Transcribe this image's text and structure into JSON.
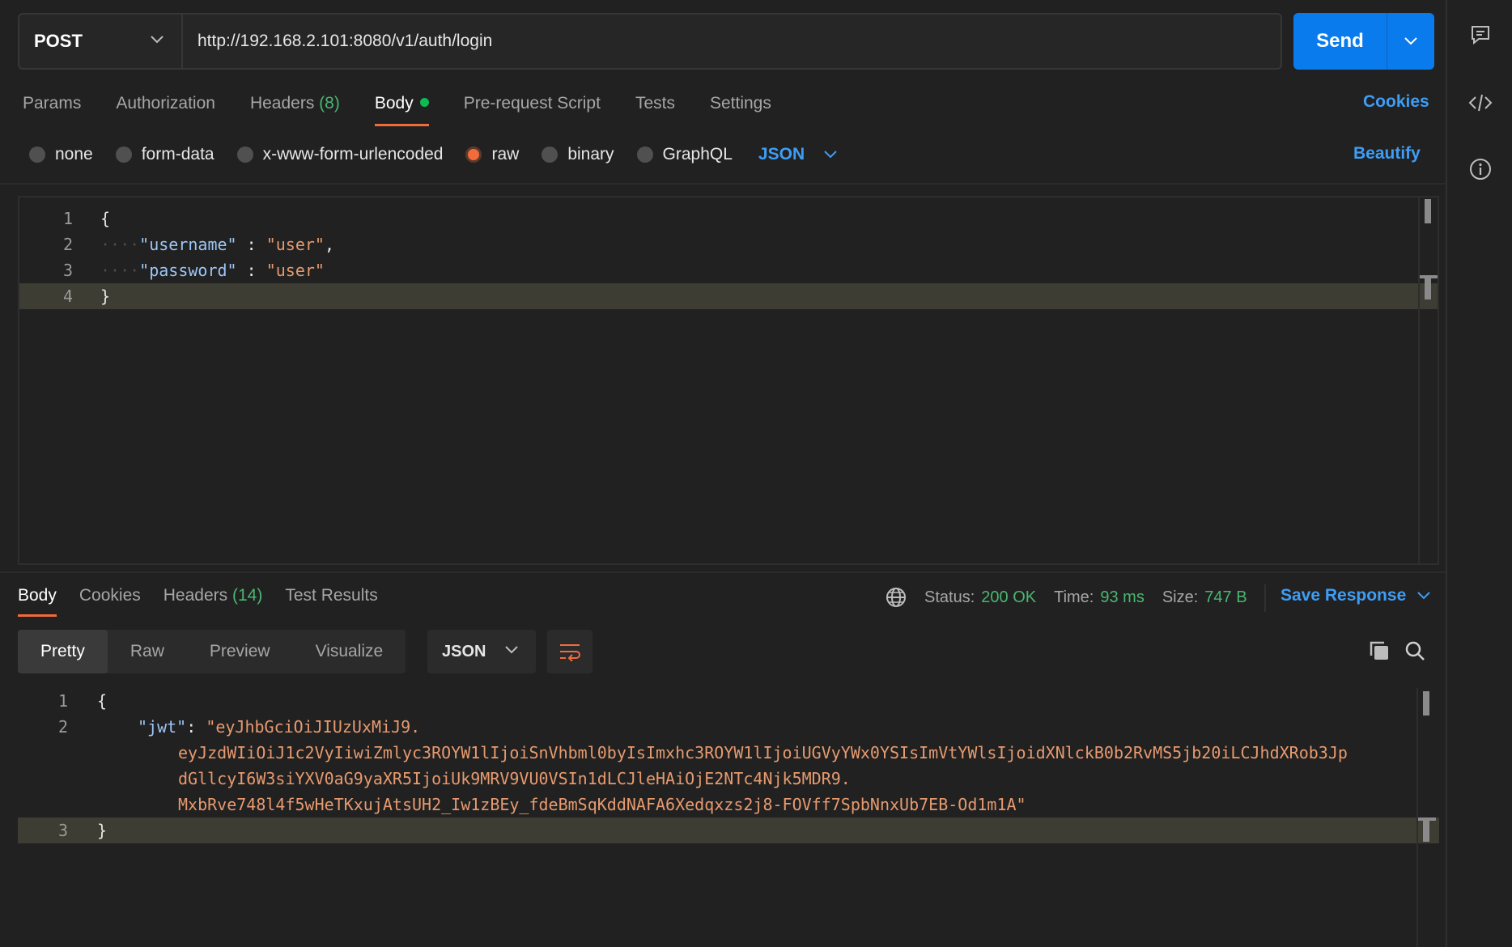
{
  "request": {
    "method": "POST",
    "url": "http://192.168.2.101:8080/v1/auth/login",
    "send_label": "Send"
  },
  "request_tabs": [
    {
      "label": "Params"
    },
    {
      "label": "Authorization"
    },
    {
      "label": "Headers",
      "count": "(8)"
    },
    {
      "label": "Body"
    },
    {
      "label": "Pre-request Script"
    },
    {
      "label": "Tests"
    },
    {
      "label": "Settings"
    }
  ],
  "cookies_label": "Cookies",
  "body_types": [
    "none",
    "form-data",
    "x-www-form-urlencoded",
    "raw",
    "binary",
    "GraphQL"
  ],
  "body_type_selected": "raw",
  "body_format": "JSON",
  "beautify_label": "Beautify",
  "request_body": {
    "line_numbers": [
      "1",
      "2",
      "3",
      "4"
    ],
    "line1": "{",
    "line2_key": "\"username\"",
    "line2_sep": " : ",
    "line2_val": "\"user\"",
    "line2_end": ",",
    "line3_key": "\"password\"",
    "line3_sep": " : ",
    "line3_val": "\"user\"",
    "line4": "}",
    "indent_marks": "····"
  },
  "response_tabs": [
    {
      "label": "Body"
    },
    {
      "label": "Cookies"
    },
    {
      "label": "Headers",
      "count": "(14)"
    },
    {
      "label": "Test Results"
    }
  ],
  "status": {
    "status_label": "Status:",
    "status_value": "200 OK",
    "time_label": "Time:",
    "time_value": "93 ms",
    "size_label": "Size:",
    "size_value": "747 B"
  },
  "save_response_label": "Save Response",
  "view_modes": [
    "Pretty",
    "Raw",
    "Preview",
    "Visualize"
  ],
  "response_format": "JSON",
  "response_body": {
    "line_numbers": [
      "1",
      "2",
      "3"
    ],
    "line1": "{",
    "jwt_key": "\"jwt\"",
    "jwt_part1": "\"eyJhbGciOiJIUzUxMiJ9.",
    "jwt_part2": "eyJzdWIiOiJ1c2VyIiwiZmlyc3ROYW1lIjoiSnVhbml0byIsImxhc3ROYW1lIjoiUGVyYWx0YSIsImVtYWlsIjoidXNlckB0b2RvMS5jb20iLCJhdXRob3Jp",
    "jwt_part3": "dGllcyI6W3siYXV0aG9yaXR5IjoiUk9MRV9VU0VSIn1dLCJleHAiOjE2NTc4Njk5MDR9.",
    "jwt_part4": "MxbRve748l4f5wHeTKxujAtsUH2_Iw1zBEy_fdeBmSqKddNAFA6Xedqxzs2j8-FOVff7SpbNnxUb7EB-Od1m1A\"",
    "line3": "}"
  },
  "colors": {
    "accent_blue": "#097bed",
    "link_blue": "#3e9df5",
    "active_orange": "#f26b3a",
    "success_green": "#49b671",
    "json_key": "#9cc6f6",
    "json_string": "#e79a6f"
  },
  "rail_icons": [
    "comments-icon",
    "code-icon",
    "info-icon"
  ]
}
